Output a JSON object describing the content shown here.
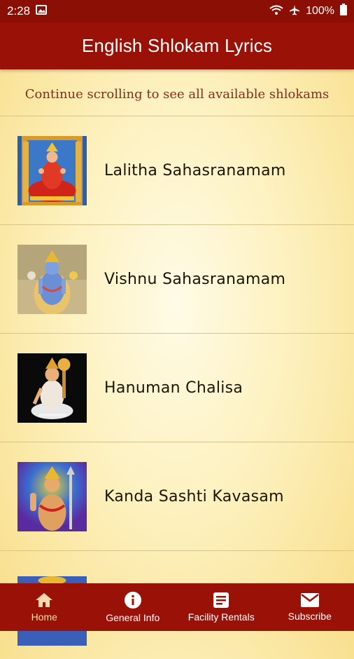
{
  "status_bar": {
    "time": "2:28",
    "battery": "100%"
  },
  "app_bar": {
    "title": "English Shlokam Lyrics"
  },
  "hint": "Continue scrolling to see all available shlokams",
  "shlokams": [
    {
      "label": "Lalitha Sahasranamam",
      "icon": "lalitha-image"
    },
    {
      "label": "Vishnu Sahasranamam",
      "icon": "vishnu-image"
    },
    {
      "label": "Hanuman Chalisa",
      "icon": "hanuman-image"
    },
    {
      "label": "Kanda Sashti Kavasam",
      "icon": "murugan-image"
    }
  ],
  "bottom_nav": [
    {
      "label": "Home",
      "icon": "home-icon",
      "active": true
    },
    {
      "label": "General Info",
      "icon": "info-icon",
      "active": false
    },
    {
      "label": "Facility Rentals",
      "icon": "document-icon",
      "active": false
    },
    {
      "label": "Subscribe",
      "icon": "mail-icon",
      "active": false
    }
  ],
  "colors": {
    "primary": "#9a1108",
    "status_bar": "#8c0f06",
    "hint_text": "#8c2a1c",
    "active_nav": "#fdd9b0"
  }
}
